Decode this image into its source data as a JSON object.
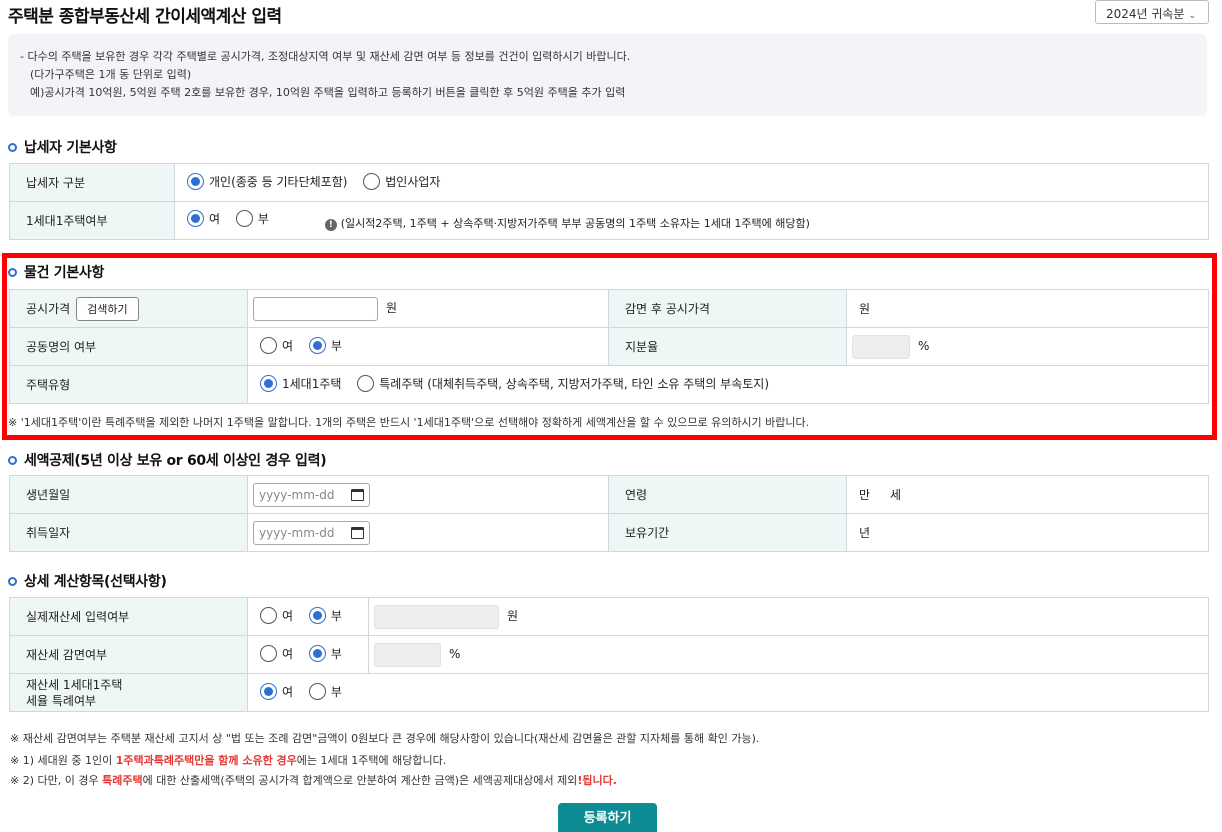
{
  "header": {
    "title": "주택분 종합부동산세 간이세액계산 입력",
    "year_select": "2024년 귀속분"
  },
  "notice": {
    "lines": [
      "- 다수의 주택을 보유한 경우 각각 주택별로 공시가격, 조정대상지역 여부 및 재산세 감면 여부 등 정보를 건건이 입력하시기 바랍니다.",
      "(다가구주택은 1개 동 단위로 입력)",
      "예)공시가격 10억원, 5억원 주택 2호를 보유한 경우, 10억원 주택을 입력하고 등록하기 버튼을 클릭한 후 5억원 주택을 추가 입력"
    ]
  },
  "taxpayer": {
    "section_title": "납세자 기본사항",
    "type_label": "납세자 구분",
    "type_options": [
      "개인(종중 등 기타단체포함)",
      "법인사업자"
    ],
    "household_label": "1세대1주택여부",
    "household_options": [
      "여",
      "부"
    ],
    "household_info": "(일시적2주택, 1주택 + 상속주택·지방저가주택 부부 공동명의 1주택 소유자는 1세대 1주택에 해당함)"
  },
  "property": {
    "section_title": "물건 기본사항",
    "price_label": "공시가격",
    "search_button": "검색하기",
    "price_unit": "원",
    "reduced_label": "감면 후 공시가격",
    "reduced_unit": "원",
    "joint_label": "공동명의 여부",
    "joint_options": [
      "여",
      "부"
    ],
    "share_label": "지분율",
    "share_unit": "%",
    "house_type_label": "주택유형",
    "house_type_options": [
      "1세대1주택",
      "특례주택 (대체취득주택, 상속주택, 지방저가주택, 타인 소유 주택의 부속토지)"
    ],
    "note": "※ '1세대1주택'이란 특례주택을 제외한 나머지 1주택을 말합니다. 1개의 주택은 반드시 '1세대1주택'으로 선택해야 정확하게 세액계산을 할 수 있으므로 유의하시기 바랍니다."
  },
  "deduction": {
    "section_title": "세액공제(5년 이상 보유 or 60세 이상인 경우 입력)",
    "birth_label": "생년월일",
    "date_placeholder": "yyyy-mm-dd",
    "age_label": "연령",
    "age_prefix": "만",
    "age_unit": "세",
    "acquire_label": "취득일자",
    "holding_label": "보유기간",
    "holding_unit": "년"
  },
  "detail": {
    "section_title": "상세 계산항목(선택사항)",
    "actual_tax_label": "실제재산세 입력여부",
    "actual_tax_options": [
      "여",
      "부"
    ],
    "actual_tax_unit": "원",
    "tax_reduce_label": "재산세 감면여부",
    "tax_reduce_options": [
      "여",
      "부"
    ],
    "tax_reduce_unit": "%",
    "special_rate_label_1": "재산세 1세대1주택",
    "special_rate_label_2": "세율 특례여부",
    "special_rate_options": [
      "여",
      "부"
    ]
  },
  "notes": {
    "n1": "※ 재산세 감면여부는 주택분 재산세 고지서 상 \"법 또는 조례 감면\"금액이 0원보다 큰 경우에 해당사항이 있습니다(재산세 감면율은 관할 지자체를 통해 확인 가능).",
    "n2_a": "※ 1) 세대원 중 1인이 ",
    "n2_red": "1주택과특례주택만을 함께 소유한 경우",
    "n2_b": "에는 1세대 1주택에 해당합니다.",
    "n3_a": "※ 2) 다만, 이 경우 ",
    "n3_red": "특례주택",
    "n3_b": "에 대한 산출세액(주택의 공시가격 합계액으로 안분하여 계산한 금액)은 세액공제대상에서 제외",
    "n3_red2": "!됩니다."
  },
  "register_button": "등록하기",
  "colors": {
    "accent": "#2f6fd1",
    "header_cell": "#eef6f6",
    "highlight": "#ff0000",
    "button": "#0e8c93",
    "note_red": "#e53935"
  }
}
